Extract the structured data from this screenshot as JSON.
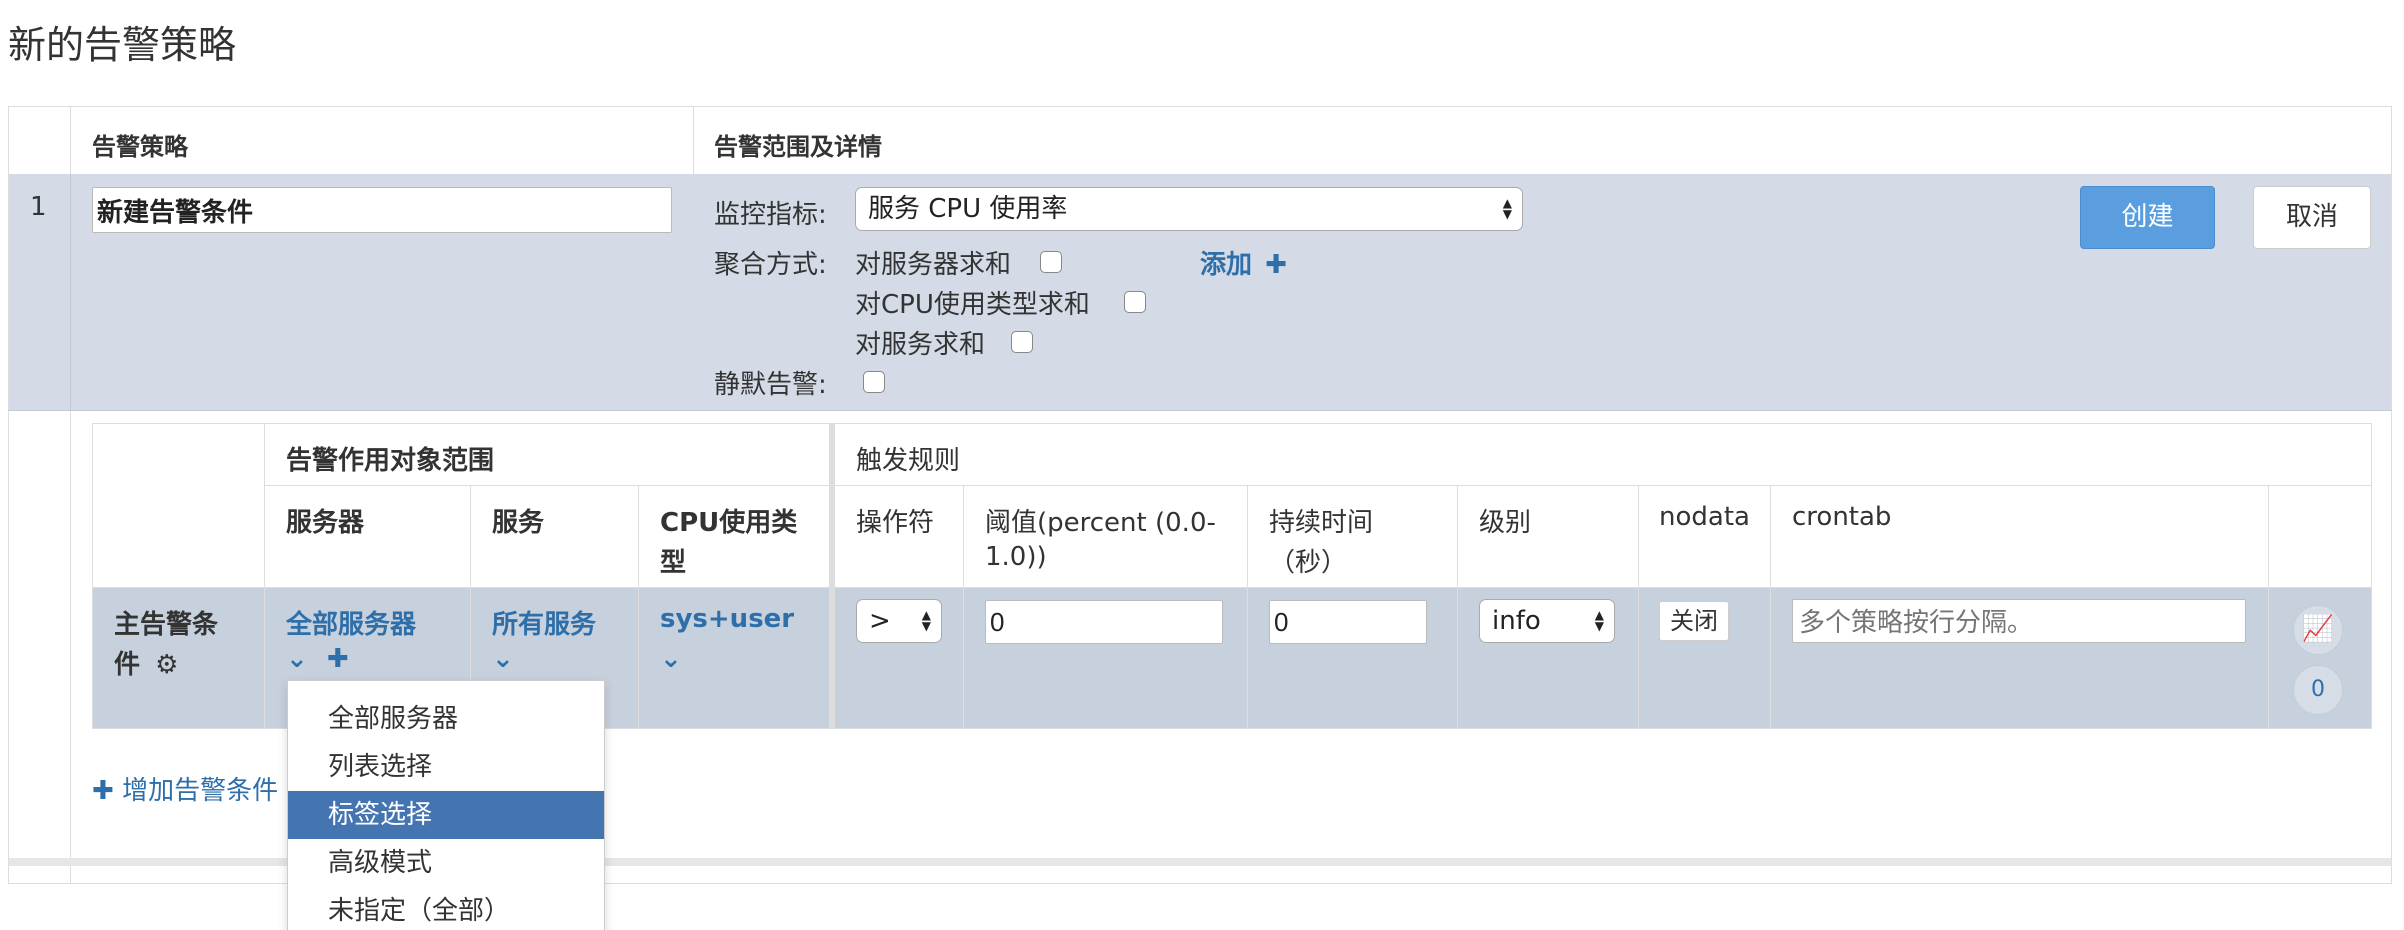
{
  "page_title": "新的告警策略",
  "header": {
    "col_policy": "告警策略",
    "col_scope": "告警范围及详情"
  },
  "row": {
    "index": "1",
    "name_value": "新建告警条件",
    "metric_label": "监控指标:",
    "metric_value": "服务 CPU 使用率",
    "agg_label": "聚合方式:",
    "agg_options": [
      "对服务器求和",
      "对CPU使用类型求和",
      "对服务求和"
    ],
    "add_label": "添加",
    "silence_label": "静默告警:",
    "create_label": "创建",
    "cancel_label": "取消"
  },
  "conditions": {
    "group_scope": "告警作用对象范围",
    "group_trigger": "触发规则",
    "columns": {
      "server": "服务器",
      "service": "服务",
      "cpu_type_1": "CPU使用类",
      "cpu_type_2": "型",
      "operator": "操作符",
      "threshold_1": "阈值(percent (0.0-",
      "threshold_2": "1.0))",
      "duration_1": "持续时间",
      "duration_2": "（秒）",
      "level": "级别",
      "nodata": "nodata",
      "crontab": "crontab"
    },
    "main_label_1": "主告警条",
    "main_label_2": "件",
    "server_value": "全部服务器",
    "service_value": "所有服务",
    "cpu_value": "sys+user",
    "operator_value": ">",
    "threshold_value": "0",
    "duration_value": "0",
    "level_value": "info",
    "nodata_value": "关闭",
    "crontab_placeholder": "多个策略按行分隔。",
    "count": "0",
    "add_condition": "增加告警条件"
  },
  "dropdown": {
    "items": [
      "全部服务器",
      "列表选择",
      "标签选择",
      "高级模式",
      "未指定（全部）"
    ],
    "selected": "标签选择"
  },
  "icons": [
    "gear-icon",
    "chevron-down-icon",
    "plus-icon",
    "chart-line-icon"
  ],
  "colors": {
    "accent": "#2e6ea9",
    "primary_button": "#5b9ee0",
    "row_bg": "#d4dbe6",
    "dropdown_selected": "#4575b0"
  }
}
